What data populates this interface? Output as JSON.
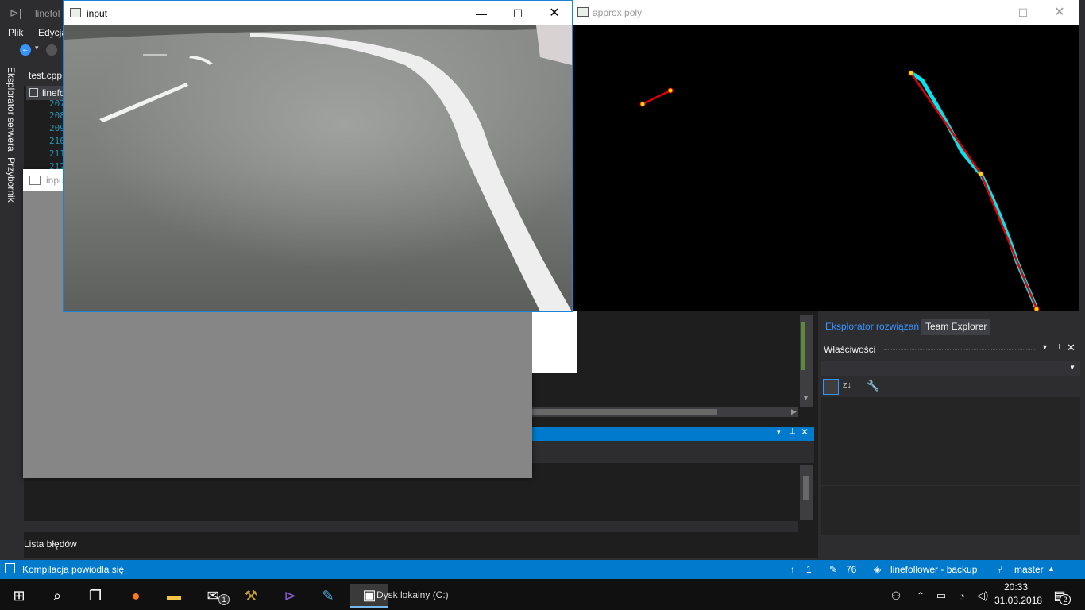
{
  "vs": {
    "menu": [
      "Plik",
      "Edycja"
    ],
    "left_tabs": [
      "Eksplorator serwera",
      "Przybornik"
    ],
    "doc_tabs": [
      "test.cpp",
      "linefollower"
    ],
    "line_numbers": [
      "207",
      "208",
      "209",
      "210",
      "211",
      "212"
    ],
    "error_list": "Lista błędów",
    "right_tabs": [
      "Eksplorator rozwiązań",
      "Team Explorer"
    ],
    "properties_title": "Właściwości"
  },
  "status": {
    "message": "Kompilacja powiodła się",
    "up_count": "1",
    "edit_count": "76",
    "repo": "linefollower - backup",
    "branch": "master"
  },
  "taskbar": {
    "time": "20:33",
    "date": "31.03.2018",
    "notif_count": "2",
    "mail_badge": "1",
    "behind_text": "Dysk lokalny (C:)"
  },
  "windows": {
    "input_title": "input",
    "poly_title": "approx poly",
    "gray_title": "input"
  },
  "colors": {
    "vs_blue": "#007acc",
    "contour": "#00e5ee",
    "poly": "#e00000",
    "vertex": "#ffd800"
  }
}
